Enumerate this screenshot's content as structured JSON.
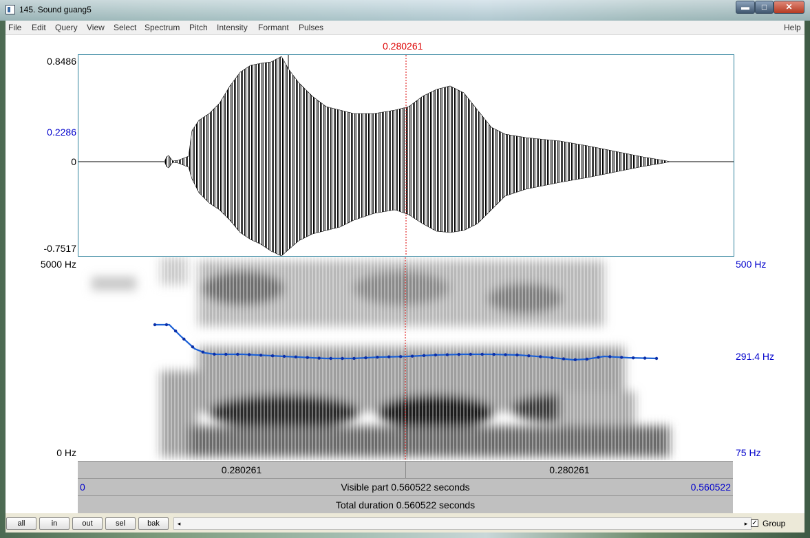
{
  "window": {
    "title": "145. Sound guang5",
    "min": "▬",
    "max": "□",
    "close": "✕"
  },
  "menu": [
    "File",
    "Edit",
    "Query",
    "View",
    "Select",
    "Spectrum",
    "Pitch",
    "Intensity",
    "Formant",
    "Pulses"
  ],
  "menu_help": "Help",
  "cursor_time": "0.280261",
  "wave": {
    "max": "0.8486",
    "mid": "0.2286",
    "zero": "0",
    "min": "-0.7517"
  },
  "spectrum": {
    "top": "5000 Hz",
    "bottom": "0 Hz"
  },
  "pitch": {
    "top": "500 Hz",
    "mid": "291.4 Hz",
    "bottom": "75 Hz"
  },
  "bars": {
    "left_part": "0.280261",
    "right_part": "0.280261",
    "start": "0",
    "visible": "Visible part 0.560522 seconds",
    "end": "0.560522",
    "total": "Total duration 0.560522 seconds"
  },
  "buttons": {
    "all": "all",
    "in": "in",
    "out": "out",
    "sel": "sel",
    "bak": "bak"
  },
  "group": {
    "label": "Group",
    "checked": true,
    "mark": "✓"
  },
  "scroll": {
    "left": "◂",
    "right": "▸"
  },
  "colors": {
    "pitch_curve": "#1a5fd6",
    "cursor": "#dd0000",
    "label_blue": "#0000cc"
  }
}
